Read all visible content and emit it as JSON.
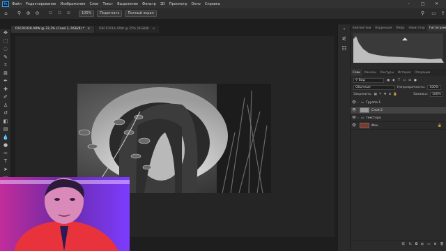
{
  "menubar": {
    "logo": "Ps",
    "items": [
      "Файл",
      "Редактирование",
      "Изображение",
      "Слои",
      "Текст",
      "Выделение",
      "Фильтр",
      "3D",
      "Просмотр",
      "Окно",
      "Справка"
    ],
    "window_controls": [
      "–",
      "□",
      "✕"
    ]
  },
  "options": {
    "zoom_value": "100%",
    "fit_button": "Подогнать",
    "fullscreen_button": "Полный экран"
  },
  "tabs": [
    {
      "label": "DSC01028.ARW @ 33,3% (Слой 2, RGB/8) *",
      "close": "×"
    },
    {
      "label": "DSC07614.ARW @ 25% (RGB/8)",
      "close": "×"
    }
  ],
  "panels": {
    "top_tabs": [
      "Библиотеки",
      "Коррекция",
      "Инфо",
      "Навигатор",
      "Гистограмма"
    ],
    "layer_tabs": [
      "Слои",
      "Каналы",
      "Контуры",
      "История",
      "Операции"
    ],
    "search_value": "Вид",
    "blend_mode": "Обычные",
    "opacity_label": "Непрозрачность:",
    "opacity_value": "100%",
    "lock_label": "Закрепить:",
    "fill_label": "Заливка:",
    "fill_value": "100%",
    "layers": [
      {
        "name": "Группа 1",
        "selected": false,
        "kind": "group"
      },
      {
        "name": "Слой 2",
        "selected": true,
        "kind": "layer"
      },
      {
        "name": "текстура",
        "selected": false,
        "kind": "group"
      },
      {
        "name": "Фон",
        "selected": false,
        "kind": "layer"
      }
    ]
  },
  "colors": {
    "accent": "#31a8ff",
    "panel": "#2b2b2b",
    "workspace": "#1e1e1e"
  }
}
